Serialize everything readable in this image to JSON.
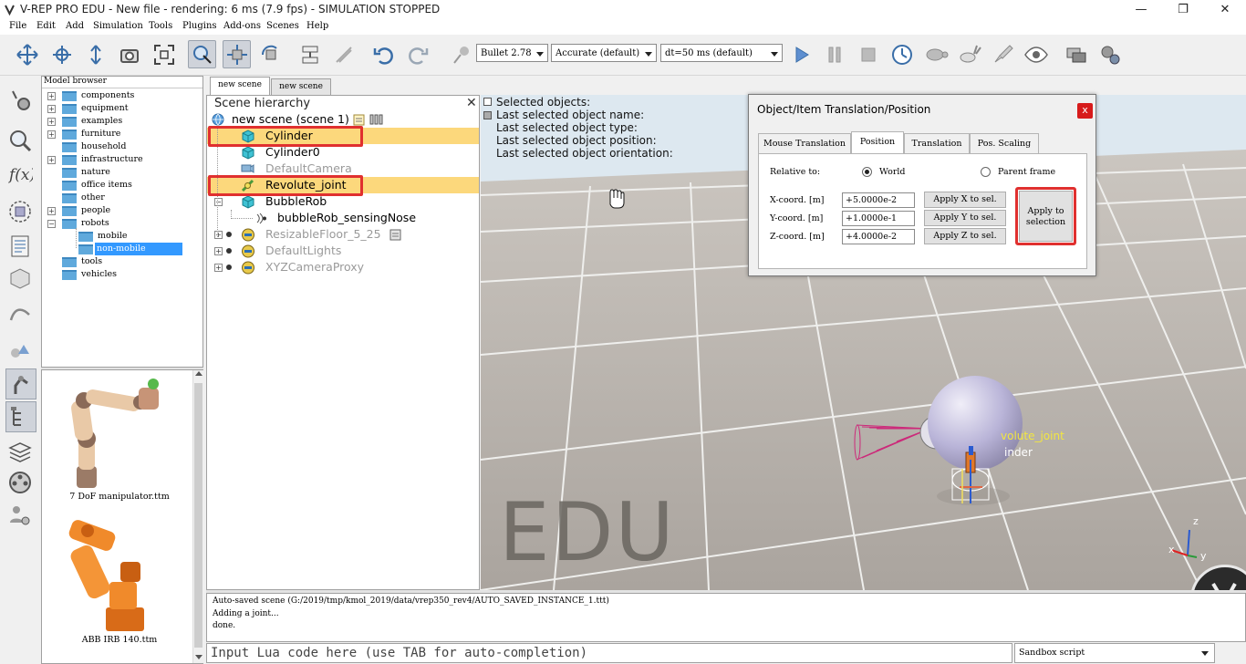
{
  "window": {
    "title": "V-REP PRO EDU - New file - rendering: 6 ms (7.9 fps) - SIMULATION STOPPED",
    "minimize": "—",
    "maximize": "❐",
    "close": "✕"
  },
  "menu": [
    "File",
    "Edit",
    "Add",
    "Simulation",
    "Tools",
    "Plugins",
    "Add-ons",
    "Scenes",
    "Help"
  ],
  "toolbar": {
    "engine": "Bullet 2.78",
    "accuracy": "Accurate (default)",
    "timestep": "dt=50 ms (default)"
  },
  "model_browser": {
    "header": "Model browser",
    "items": [
      {
        "label": "components",
        "expandable": true
      },
      {
        "label": "equipment",
        "expandable": true
      },
      {
        "label": "examples",
        "expandable": true
      },
      {
        "label": "furniture",
        "expandable": true
      },
      {
        "label": "household",
        "expandable": false
      },
      {
        "label": "infrastructure",
        "expandable": true
      },
      {
        "label": "nature",
        "expandable": false
      },
      {
        "label": "office items",
        "expandable": false
      },
      {
        "label": "other",
        "expandable": false
      },
      {
        "label": "people",
        "expandable": true
      },
      {
        "label": "robots",
        "expandable": true
      },
      {
        "label": "mobile",
        "expandable": false
      },
      {
        "label": "non-mobile",
        "expandable": false
      },
      {
        "label": "tools",
        "expandable": false
      },
      {
        "label": "vehicles",
        "expandable": false
      }
    ],
    "thumbnails": [
      {
        "label": "7 DoF manipulator.ttm"
      },
      {
        "label": "ABB IRB 140.ttm"
      }
    ]
  },
  "scene_tabs": [
    "new scene",
    "new scene"
  ],
  "hierarchy": {
    "title": "Scene hierarchy",
    "close": "✕",
    "items": [
      {
        "label": "new scene (scene 1)",
        "selected": false
      },
      {
        "label": "Cylinder",
        "selected": true
      },
      {
        "label": "Cylinder0",
        "selected": false
      },
      {
        "label": "DefaultCamera",
        "selected": false
      },
      {
        "label": "Revolute_joint",
        "selected": true
      },
      {
        "label": "BubbleRob",
        "selected": false
      },
      {
        "label": "bubbleRob_sensingNose",
        "selected": false
      },
      {
        "label": "ResizableFloor_5_25",
        "selected": false
      },
      {
        "label": "DefaultLights",
        "selected": false
      },
      {
        "label": "XYZCameraProxy",
        "selected": false
      }
    ]
  },
  "viewport": {
    "info": [
      "Selected objects:",
      "Last selected object name:",
      "Last selected object type:",
      "Last selected object position:",
      "Last selected object orientation:"
    ],
    "watermark": "EDU",
    "label_joint": "volute_joint",
    "label_cyl": "inder",
    "axis_z": "z",
    "axis_x": "x",
    "axis_y": "y"
  },
  "dialog": {
    "title": "Object/Item Translation/Position",
    "close": "x",
    "tabs": [
      "Mouse Translation",
      "Position",
      "Translation",
      "Pos. Scaling"
    ],
    "active_tab": "Position",
    "relative_label": "Relative to:",
    "opt_world": "World",
    "opt_parent": "Parent frame",
    "x_label": "X-coord. [m]",
    "y_label": "Y-coord. [m]",
    "z_label": "Z-coord. [m]",
    "x_value": "+5.0000e-2",
    "y_value": "+1.0000e-1",
    "z_value": "+4.0000e-2",
    "apply_x": "Apply X to sel.",
    "apply_y": "Apply Y to sel.",
    "apply_z": "Apply Z to sel.",
    "apply_all_1": "Apply to",
    "apply_all_2": "selection"
  },
  "console": {
    "lines": [
      "Auto-saved scene (G:/2019/tmp/kmol_2019/data/vrep350_rev4/AUTO_SAVED_INSTANCE_1.ttt)",
      "Adding a joint...",
      "done."
    ],
    "lua_placeholder": "Input Lua code here (use TAB for auto-completion)",
    "script_mode": "Sandbox script"
  },
  "colors": {
    "selection": "#fcd87c",
    "highlight_box": "#e0302f",
    "folder": "#5fa9dc",
    "dialog_close": "#d71b1b"
  }
}
